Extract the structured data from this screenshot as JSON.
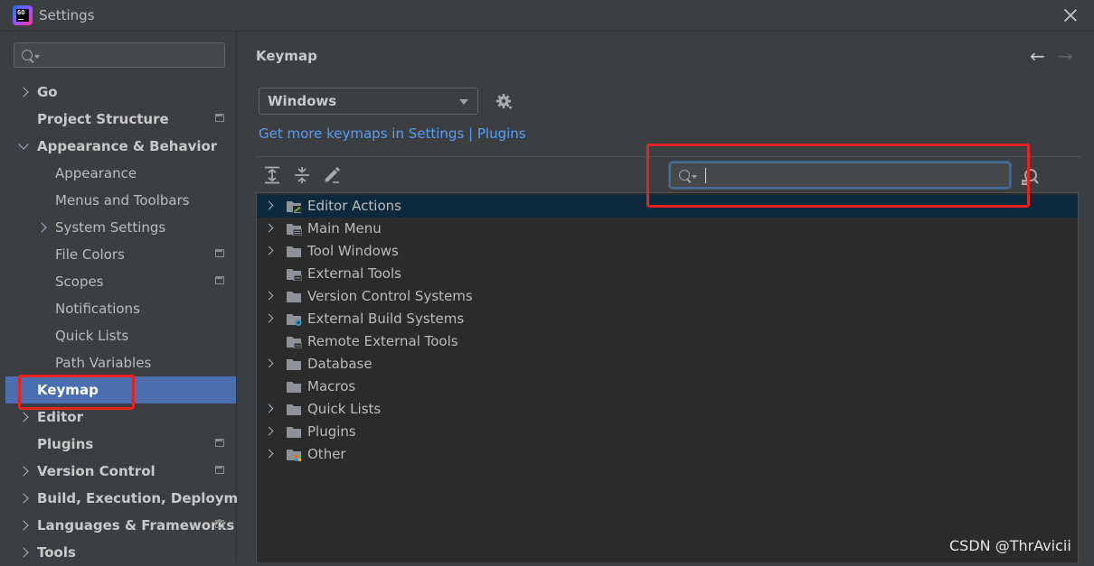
{
  "window": {
    "app_icon_text": "GO",
    "title": "Settings"
  },
  "sidebar": {
    "search_placeholder": "",
    "items": [
      {
        "label": "Go",
        "level": 0,
        "chevron": "right",
        "bold": true
      },
      {
        "label": "Project Structure",
        "level": 0,
        "chevron": "none",
        "bold": true,
        "badge": true
      },
      {
        "label": "Appearance & Behavior",
        "level": 0,
        "chevron": "down",
        "bold": true
      },
      {
        "label": "Appearance",
        "level": 1,
        "chevron": "none"
      },
      {
        "label": "Menus and Toolbars",
        "level": 1,
        "chevron": "none"
      },
      {
        "label": "System Settings",
        "level": 1,
        "chevron": "right"
      },
      {
        "label": "File Colors",
        "level": 1,
        "chevron": "none",
        "badge": true
      },
      {
        "label": "Scopes",
        "level": 1,
        "chevron": "none",
        "badge": true
      },
      {
        "label": "Notifications",
        "level": 1,
        "chevron": "none"
      },
      {
        "label": "Quick Lists",
        "level": 1,
        "chevron": "none"
      },
      {
        "label": "Path Variables",
        "level": 1,
        "chevron": "none"
      },
      {
        "label": "Keymap",
        "level": 0,
        "chevron": "none",
        "bold": true,
        "selected": true
      },
      {
        "label": "Editor",
        "level": 0,
        "chevron": "right",
        "bold": true
      },
      {
        "label": "Plugins",
        "level": 0,
        "chevron": "none",
        "bold": true,
        "badge": true
      },
      {
        "label": "Version Control",
        "level": 0,
        "chevron": "right",
        "bold": true,
        "badge": true
      },
      {
        "label": "Build, Execution, Deployment",
        "level": 0,
        "chevron": "right",
        "bold": true
      },
      {
        "label": "Languages & Frameworks",
        "level": 0,
        "chevron": "right",
        "bold": true,
        "badge": true
      },
      {
        "label": "Tools",
        "level": 0,
        "chevron": "right",
        "bold": true
      }
    ]
  },
  "main": {
    "heading": "Keymap",
    "nav_back": "←",
    "nav_forward": "→",
    "keymap_select": "Windows",
    "link_part1": "Get more keymaps in Settings",
    "link_sep": "|",
    "link_part2": "Plugins",
    "search_value": "",
    "actions_tree": [
      {
        "label": "Editor Actions",
        "expandable": true,
        "icon": "editor-actions-folder-icon",
        "selected": true
      },
      {
        "label": "Main Menu",
        "expandable": true,
        "icon": "main-menu-folder-icon"
      },
      {
        "label": "Tool Windows",
        "expandable": true,
        "icon": "folder-icon"
      },
      {
        "label": "External Tools",
        "expandable": false,
        "icon": "external-tools-folder-icon"
      },
      {
        "label": "Version Control Systems",
        "expandable": true,
        "icon": "folder-icon"
      },
      {
        "label": "External Build Systems",
        "expandable": true,
        "icon": "build-systems-folder-icon"
      },
      {
        "label": "Remote External Tools",
        "expandable": false,
        "icon": "external-tools-folder-icon"
      },
      {
        "label": "Database",
        "expandable": true,
        "icon": "folder-icon"
      },
      {
        "label": "Macros",
        "expandable": false,
        "icon": "folder-icon"
      },
      {
        "label": "Quick Lists",
        "expandable": true,
        "icon": "folder-icon"
      },
      {
        "label": "Plugins",
        "expandable": true,
        "icon": "folder-icon"
      },
      {
        "label": "Other",
        "expandable": true,
        "icon": "other-folder-icon"
      }
    ]
  },
  "watermark": "CSDN @ThrAvicii",
  "colors": {
    "panel_bg": "#3c3f41",
    "tree_bg": "#2b2b2b",
    "selection": "#4b6eaf",
    "tree_selection": "#0d293e",
    "link": "#589df6",
    "annotation_red": "#e8221c"
  }
}
